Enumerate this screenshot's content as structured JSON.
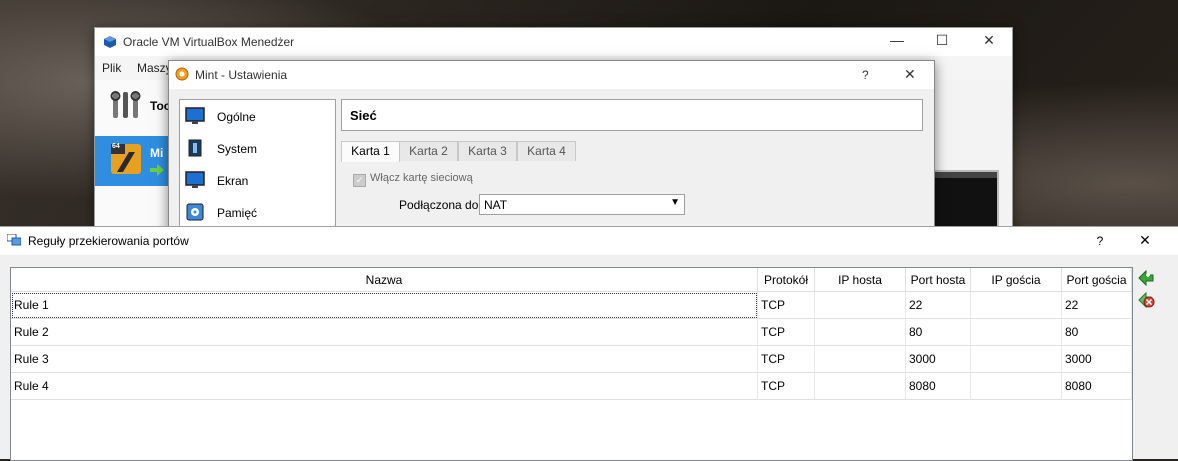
{
  "vbox_manager": {
    "title": "Oracle VM VirtualBox Menedżer",
    "menu": [
      "Plik",
      "Maszy"
    ],
    "tools_label": "Too",
    "vm_label": "Mi",
    "vm_badge": "64"
  },
  "settings": {
    "title": "Mint - Ustawienia",
    "help": "?",
    "close": "✕",
    "categories": [
      "Ogólne",
      "System",
      "Ekran",
      "Pamięć"
    ],
    "page_title": "Sieć",
    "tabs": [
      "Karta 1",
      "Karta 2",
      "Karta 3",
      "Karta 4"
    ],
    "enable_adapter_label": "Włącz kartę sieciową",
    "attached_to_label": "Podłączona do:",
    "attached_to_value": "NAT"
  },
  "port_forwarding": {
    "title": "Reguły przekierowania portów",
    "help": "?",
    "close": "✕",
    "columns": [
      "Nazwa",
      "Protokół",
      "IP hosta",
      "Port hosta",
      "IP gościa",
      "Port gościa"
    ],
    "rows": [
      {
        "name": "Rule 1",
        "protocol": "TCP",
        "host_ip": "",
        "host_port": "22",
        "guest_ip": "",
        "guest_port": "22"
      },
      {
        "name": "Rule 2",
        "protocol": "TCP",
        "host_ip": "",
        "host_port": "80",
        "guest_ip": "",
        "guest_port": "80"
      },
      {
        "name": "Rule 3",
        "protocol": "TCP",
        "host_ip": "",
        "host_port": "3000",
        "guest_ip": "",
        "guest_port": "3000"
      },
      {
        "name": "Rule 4",
        "protocol": "TCP",
        "host_ip": "",
        "host_port": "8080",
        "guest_ip": "",
        "guest_port": "8080"
      }
    ],
    "add_button_icon": "add-rule-icon",
    "remove_button_icon": "remove-rule-icon"
  },
  "colors": {
    "selection_blue": "#2f8ee0",
    "add_green": "#3aa53a",
    "remove_red": "#d9453a"
  }
}
